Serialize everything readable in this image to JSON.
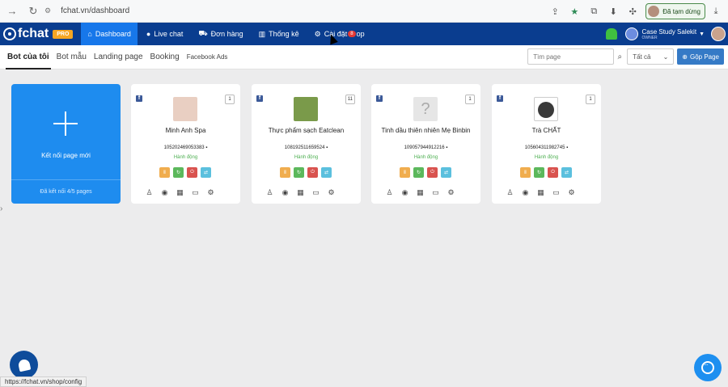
{
  "browser": {
    "url": "fchat.vn/dashboard",
    "paused_label": "Đã tạm dừng"
  },
  "nav": {
    "logo": "fchat",
    "pro_badge": "PRO",
    "items": [
      {
        "label": "Dashboard",
        "icon": "dashboard-icon"
      },
      {
        "label": "Live chat",
        "icon": "chat-icon"
      },
      {
        "label": "Đơn hàng",
        "icon": "cart-icon"
      },
      {
        "label": "Thống kê",
        "icon": "chart-icon"
      },
      {
        "label": "Cài đặt",
        "icon": "settings-icon"
      }
    ],
    "settings_badge": "8",
    "settings_suffix": "op",
    "account_name": "Case Study Salekit",
    "account_role": "OWNER"
  },
  "subnav": {
    "tabs": [
      "Bot của tôi",
      "Bot mẫu",
      "Landing page",
      "Booking",
      "Facebook Ads"
    ],
    "search_placeholder": "Tìm page",
    "filter_value": "Tất cả",
    "merge_label": "Gộp Page"
  },
  "add_card": {
    "label": "Kết nối page mới",
    "footer": "Đã kết nối 4/5 pages"
  },
  "pages": [
    {
      "name": "Minh Anh Spa",
      "id": "105202469053383",
      "status": "Hành động",
      "count": "1",
      "thumb_color": "#e9cfc2"
    },
    {
      "name": "Thực phẩm sạch Eatclean",
      "id": "108192511659524",
      "status": "Hành động",
      "count": "11",
      "thumb_color": "#7a9a4a"
    },
    {
      "name": "Tinh dầu thiên nhiên Mẹ Binbin",
      "id": "109057944912216",
      "status": "Hành động",
      "count": "1",
      "thumb_color": "#e6e6e6"
    },
    {
      "name": "Trà CHẤT",
      "id": "105604311982745",
      "status": "Hành động",
      "count": "1",
      "thumb_color": "#3a3a3a"
    }
  ],
  "status_bar_url": "https://fchat.vn/shop/config",
  "colors": {
    "nav_bg": "#0a3d8f",
    "active_tab": "#1777ea",
    "add_card": "#1e8cef",
    "merge_btn": "#357ac6"
  }
}
